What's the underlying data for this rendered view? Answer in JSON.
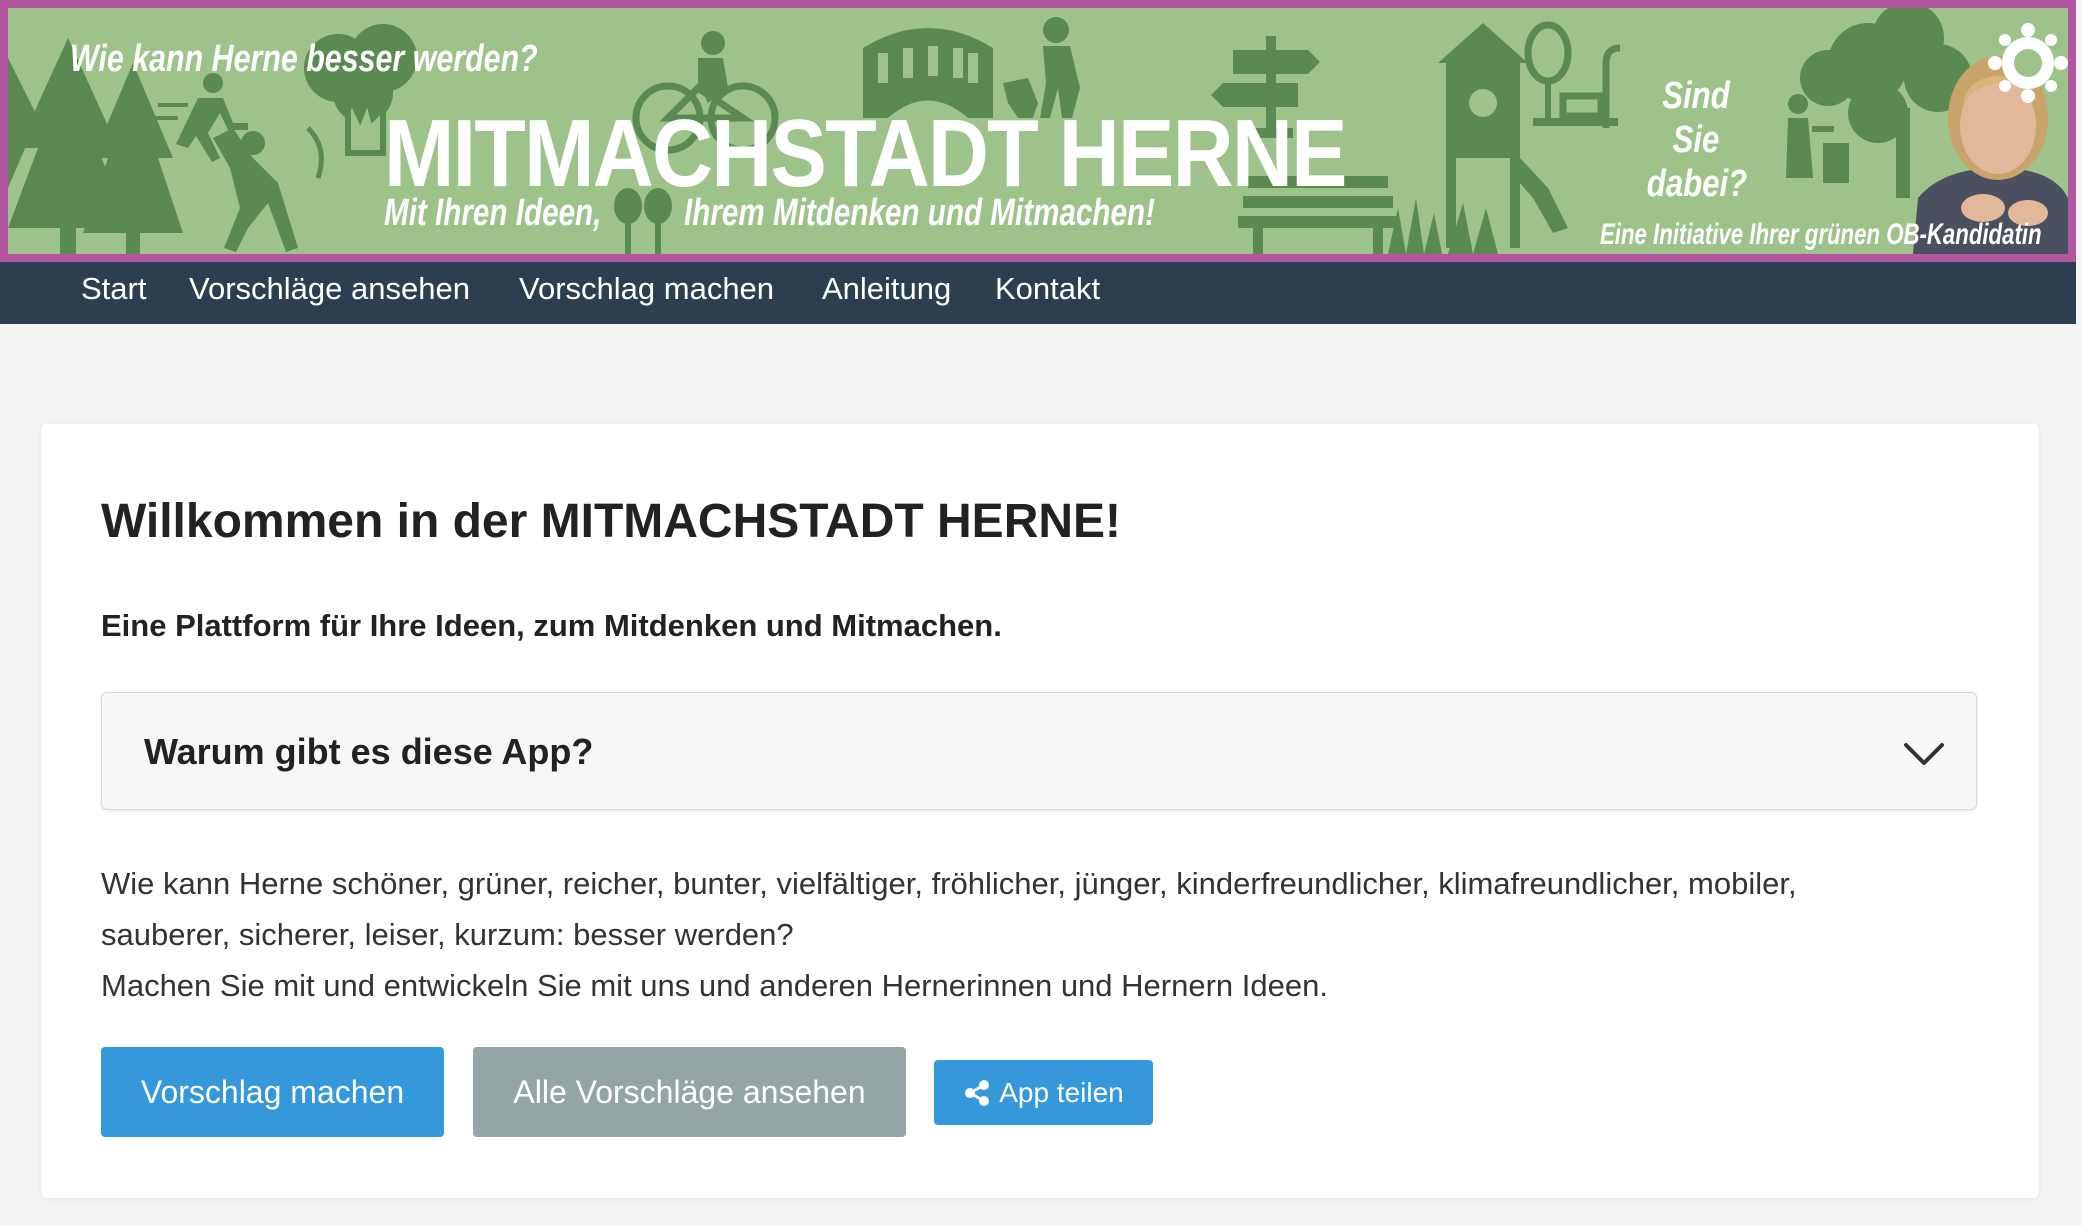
{
  "banner": {
    "question": "Wie kann Herne besser werden?",
    "title": "MITMACHSTADT HERNE",
    "subtitle_part1": "Mit Ihren Ideen,",
    "subtitle_part2": "Ihrem Mitdenken und Mitmachen!",
    "cta_line1": "Sind Sie",
    "cta_line2": "dabei?",
    "initiative": "Eine Initiative Ihrer grünen OB-Kandidatin",
    "colors": {
      "background": "#9dc38b",
      "border": "#b356a0",
      "illustration": "#5a8a52"
    }
  },
  "nav": {
    "items": [
      {
        "label": "Start"
      },
      {
        "label": "Vorschläge ansehen"
      },
      {
        "label": "Vorschlag machen"
      },
      {
        "label": "Anleitung"
      },
      {
        "label": "Kontakt"
      }
    ],
    "background": "#2c3e50"
  },
  "main": {
    "heading": "Willkommen in der MITMACHSTADT HERNE!",
    "lead": "Eine Plattform für Ihre Ideen, zum Mitdenken und Mitmachen.",
    "accordion": {
      "title": "Warum gibt es diese App?",
      "expanded": false
    },
    "paragraph_line1": "Wie kann Herne schöner, grüner, reicher, bunter, vielfältiger, fröhlicher, jünger, kinderfreundlicher, klimafreundlicher, mobiler,",
    "paragraph_line2": "sauberer, sicherer, leiser, kurzum: besser werden?",
    "paragraph_line3": "Machen Sie mit und entwickeln Sie mit uns und anderen Hernerinnen und Hernern Ideen.",
    "buttons": {
      "primary": "Vorschlag machen",
      "secondary": "Alle Vorschläge ansehen",
      "share": "App teilen",
      "share_icon": "share-icon"
    },
    "colors": {
      "primary": "#3498db",
      "secondary": "#95a5a6"
    }
  }
}
